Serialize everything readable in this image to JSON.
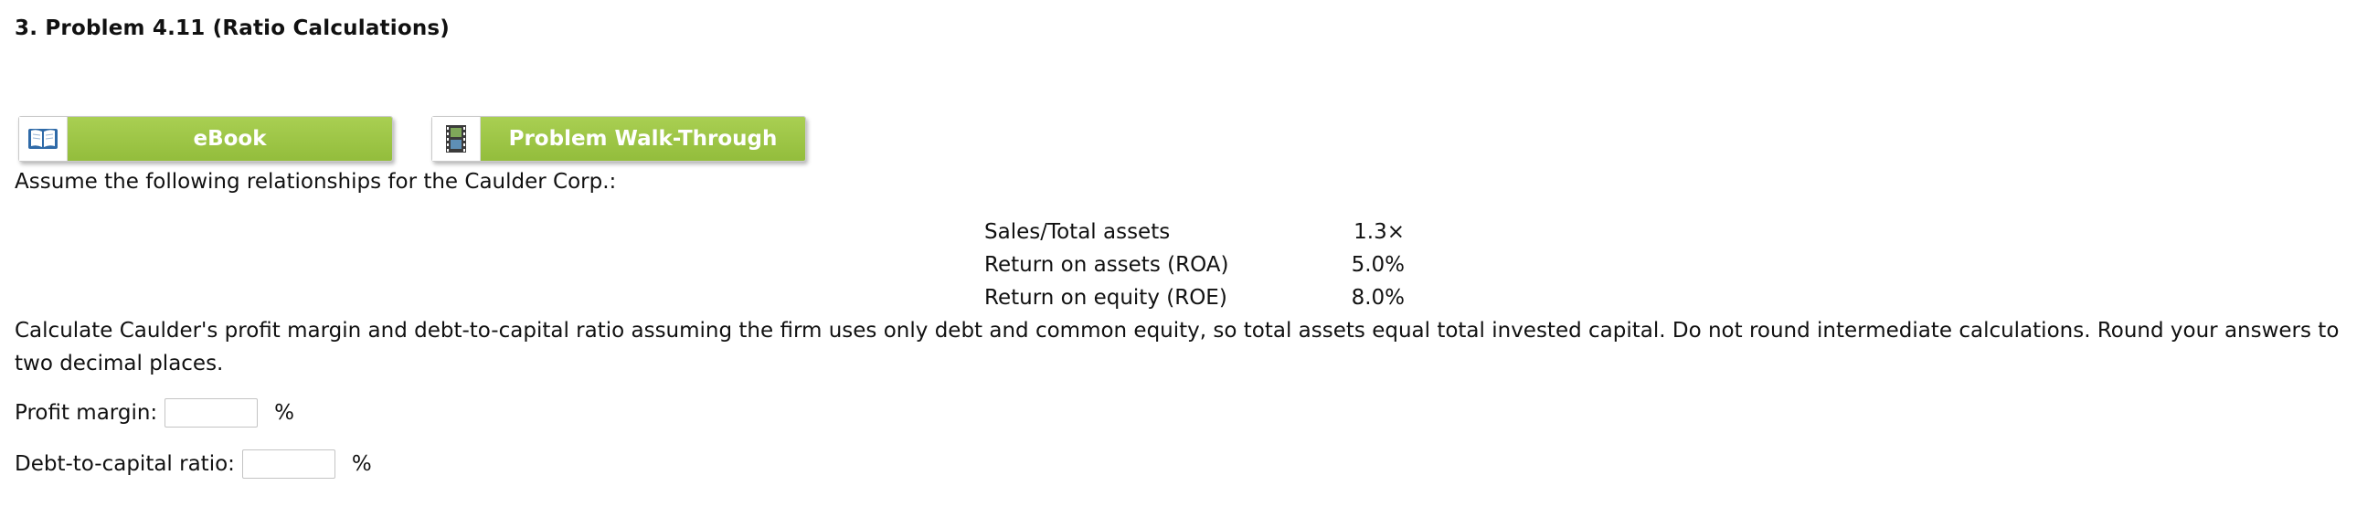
{
  "problem": {
    "title": "3.  Problem 4.11 (Ratio Calculations)"
  },
  "buttons": {
    "ebook": {
      "label": "eBook",
      "icon": "open-book-icon"
    },
    "walkthrough": {
      "label": "Problem Walk-Through",
      "icon": "film-strip-icon"
    }
  },
  "intro_text": "Assume the following relationships for the Caulder Corp.:",
  "ratios": [
    {
      "label": "Sales/Total assets",
      "value": "1.3×"
    },
    {
      "label": "Return on assets (ROA)",
      "value": "5.0%"
    },
    {
      "label": "Return on equity (ROE)",
      "value": "8.0%"
    }
  ],
  "instructions": "Calculate Caulder's profit margin and debt-to-capital ratio assuming the firm uses only debt and common equity, so total assets equal total invested capital. Do not round intermediate calculations. Round your answers to two decimal places.",
  "answers": {
    "profit_margin": {
      "label": "Profit margin:",
      "value": "",
      "unit": "%"
    },
    "debt_to_capital": {
      "label": "Debt-to-capital ratio:",
      "value": "",
      "unit": "%"
    }
  },
  "colors": {
    "button_green": "#9fc84a",
    "button_text": "#ffffff"
  }
}
